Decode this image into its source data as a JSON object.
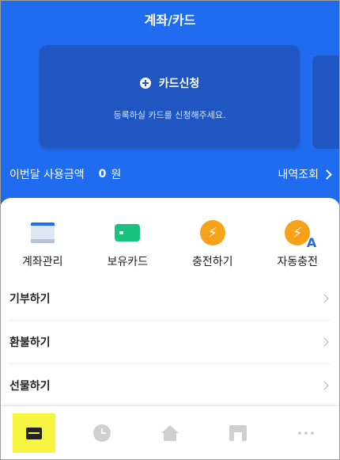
{
  "header": {
    "title": "계좌/카드"
  },
  "card_apply": {
    "label": "카드신청",
    "subtitle": "등록하실 카드를 신청해주세요."
  },
  "usage": {
    "label": "이번달 사용금액",
    "amount": "0",
    "unit": "원",
    "history_label": "내역조회"
  },
  "quick_actions": [
    {
      "label": "계좌관리",
      "icon": "account-wallet-icon"
    },
    {
      "label": "보유카드",
      "icon": "card-icon"
    },
    {
      "label": "충전하기",
      "icon": "charge-bolt-icon"
    },
    {
      "label": "자동충전",
      "icon": "auto-charge-icon",
      "badge": "A"
    }
  ],
  "menu": [
    {
      "label": "기부하기"
    },
    {
      "label": "환불하기"
    },
    {
      "label": "선물하기"
    }
  ],
  "bottom_nav": [
    {
      "name": "wallet",
      "icon": "wallet-icon",
      "active": true
    },
    {
      "name": "history",
      "icon": "clock-icon",
      "active": false
    },
    {
      "name": "home",
      "icon": "home-icon",
      "active": false
    },
    {
      "name": "store",
      "icon": "store-icon",
      "active": false
    },
    {
      "name": "more",
      "icon": "more-icon",
      "active": false
    }
  ],
  "colors": {
    "primary": "#1f6cf0",
    "card": "#1f56c1",
    "active_nav": "#f7f43f",
    "charge": "#f7a21a",
    "card_green": "#19c37d"
  }
}
